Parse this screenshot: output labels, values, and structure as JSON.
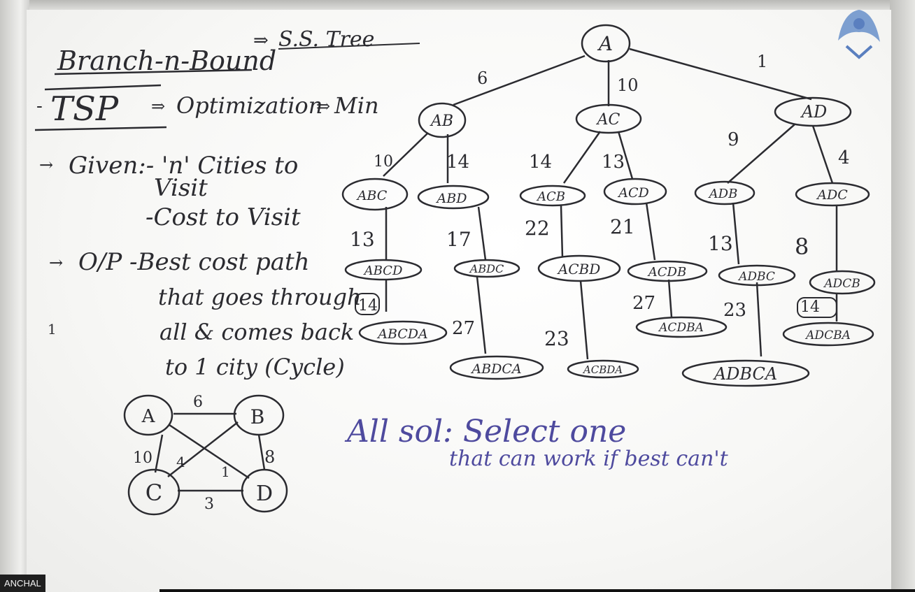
{
  "notes": {
    "heading": "Branch-n-Bound",
    "heading_arrow": "S.S. Tree",
    "tsp_line": "TSP",
    "tsp_arrow1": "Optimization",
    "tsp_arrow2": "Min",
    "given_line1": "Given:- 'n' Cities to",
    "given_line2": "Visit",
    "given_line3": "-Cost to Visit",
    "op_line1": "O/P -Best cost path",
    "op_line2": "that goes through",
    "op_line3": "all & comes back",
    "op_line4": "to 1 city (Cycle)",
    "tick": "1"
  },
  "graph": {
    "nodes": [
      "A",
      "B",
      "C",
      "D"
    ],
    "edge_weights": {
      "ab": "6",
      "ac": "10",
      "bd": "8",
      "cd": "3",
      "bc": "4",
      "ad": "1"
    }
  },
  "tree": {
    "root": "A",
    "level1": [
      {
        "label": "AB",
        "cost": "6"
      },
      {
        "label": "AC",
        "cost": "10"
      },
      {
        "label": "AD",
        "cost": "1"
      }
    ],
    "level2": [
      {
        "label": "ABC",
        "cost": "10"
      },
      {
        "label": "ABD",
        "cost": "14"
      },
      {
        "label": "ACB",
        "cost": "14"
      },
      {
        "label": "ACD",
        "cost": "13"
      },
      {
        "label": "ADB",
        "cost": "9"
      },
      {
        "label": "ADC",
        "cost": "4"
      }
    ],
    "level3": [
      {
        "label": "ABCD",
        "cost": "13"
      },
      {
        "label": "ABDC",
        "cost": "17"
      },
      {
        "label": "ACBD",
        "cost": "22"
      },
      {
        "label": "ACDB",
        "cost": "21"
      },
      {
        "label": "ADBC",
        "cost": "13"
      },
      {
        "label": "ADCB",
        "cost": "8"
      }
    ],
    "level4": [
      {
        "label": "ABCDA",
        "cost": "14"
      },
      {
        "label": "ABDCA",
        "cost": "27"
      },
      {
        "label": "ACBDA",
        "cost": "23"
      },
      {
        "label": "ACDBA",
        "cost": "27"
      },
      {
        "label": "ADBCA",
        "cost": "23"
      },
      {
        "label": "ADCBA",
        "cost": "14"
      }
    ]
  },
  "solution_note": {
    "line1": "All sol: Select one",
    "line2": "that can work if best can't"
  },
  "name_tag": "ANCHAL"
}
